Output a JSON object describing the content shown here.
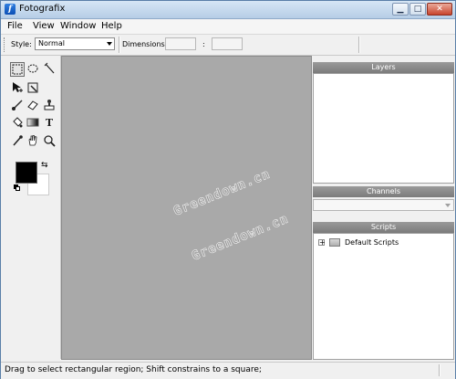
{
  "window": {
    "title": "Fotografix",
    "title_icon": "f",
    "controls": [
      "minimize-icon",
      "maximize-icon",
      "close-icon"
    ]
  },
  "menu": {
    "items": [
      "File",
      "View",
      "Window",
      "Help"
    ]
  },
  "options": {
    "style_label": "Style:",
    "style_value": "Normal",
    "dimensions_label": "Dimensions:",
    "dimension_width": "",
    "dimension_height": "",
    "dimension_separator": ":"
  },
  "tools": [
    {
      "name": "rectangular-select",
      "icon": "marquee-rect-icon",
      "active": true
    },
    {
      "name": "ellipse-select",
      "icon": "marquee-ellipse-icon"
    },
    {
      "name": "magic-wand",
      "icon": "magic-wand-icon"
    },
    {
      "name": "move",
      "icon": "move-arrow-icon"
    },
    {
      "name": "crop",
      "icon": "crop-icon"
    },
    {
      "name": "brush",
      "icon": "brush-icon"
    },
    {
      "name": "eraser",
      "icon": "eraser-icon"
    },
    {
      "name": "clone-stamp",
      "icon": "stamp-icon"
    },
    {
      "name": "paint-bucket",
      "icon": "bucket-icon"
    },
    {
      "name": "gradient",
      "icon": "gradient-icon"
    },
    {
      "name": "text",
      "icon": "text-icon",
      "glyph": "T"
    },
    {
      "name": "eyedropper",
      "icon": "eyedropper-icon"
    },
    {
      "name": "hand",
      "icon": "hand-icon"
    },
    {
      "name": "zoom",
      "icon": "magnifier-icon"
    }
  ],
  "colors": {
    "foreground": "#000000",
    "background": "#ffffff",
    "canvas": "#a9a9a9"
  },
  "canvas": {
    "watermarks": [
      "Greendown.cn",
      "Greendown.cn"
    ]
  },
  "panels": {
    "layers": {
      "title": "Layers"
    },
    "channels": {
      "title": "Channels",
      "combo_value": ""
    },
    "scripts": {
      "title": "Scripts",
      "tree": [
        {
          "expander": "+",
          "label": "Default Scripts"
        }
      ]
    }
  },
  "status": {
    "text": "Drag to select rectangular region; Shift constrains to a square;"
  }
}
